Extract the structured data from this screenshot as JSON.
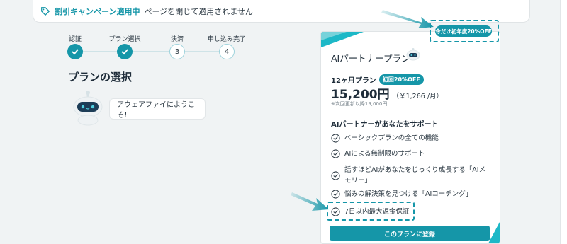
{
  "banner": {
    "highlight": "割引キャンペーン適用中",
    "message": "ページを閉じて適用されません"
  },
  "stepper": {
    "steps": [
      {
        "label": "認証",
        "number": "1",
        "state": "done"
      },
      {
        "label": "プラン選択",
        "number": "2",
        "state": "done"
      },
      {
        "label": "決済",
        "number": "3",
        "state": "todo"
      },
      {
        "label": "申し込み完了",
        "number": "4",
        "state": "todo"
      }
    ]
  },
  "main": {
    "title": "プランの選択",
    "welcome": "アウェアファイにようこそ！"
  },
  "card": {
    "discount_badge": "今だけ初年度20%OFF",
    "title": "AIパートナープラン",
    "plan_name": "12ヶ月プラン",
    "first_time_badge": "初回20%OFF",
    "price": "15,200円",
    "per_month": "（￥1,266 /月）",
    "renew_note": "※次回更新以降19,000円",
    "support_title": "AIパートナーがあなたをサポート",
    "features": [
      "ベーシックプランの全ての機能",
      "AIによる無制限のサポート",
      "話すほどAIがあなたをじっくり成長する「AIメモリー」",
      "悩みの解決策を見つける「AIコーチング」",
      "7日以内最大返金保証"
    ],
    "cta_label": "このプランに登録"
  },
  "colors": {
    "accent": "#1596a8",
    "corner": "#1db8c7",
    "background": "#f0f3f4"
  }
}
